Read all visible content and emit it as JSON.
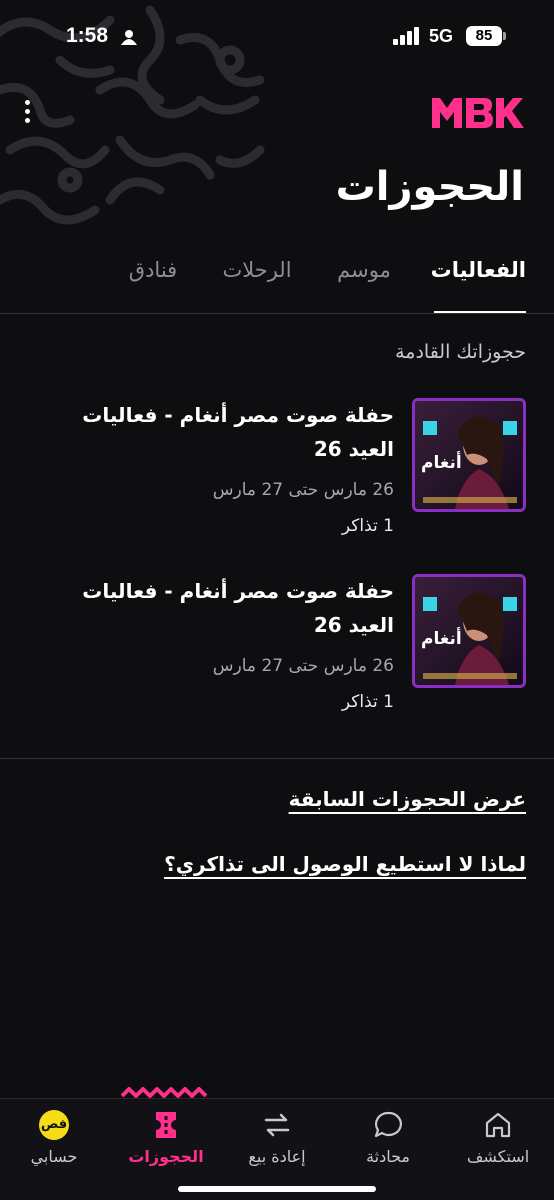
{
  "status_bar": {
    "time": "1:58",
    "network": "5G",
    "battery": "85"
  },
  "header": {
    "logo_text": "MBK",
    "title": "الحجوزات",
    "brand_color": "#ff2f8c"
  },
  "tabs": [
    {
      "label": "الفعاليات",
      "active": true
    },
    {
      "label": "موسم",
      "active": false
    },
    {
      "label": "الرحلات",
      "active": false
    },
    {
      "label": "فنادق",
      "active": false
    }
  ],
  "upcoming": {
    "section_title": "حجوزاتك القادمة",
    "bookings": [
      {
        "title": "حفلة صوت مصر أنغام  - فعاليات العيد 26",
        "dates": "26 مارس حتى 27 مارس",
        "tickets": "1 تذاكر",
        "poster_text": "أنغام"
      },
      {
        "title": "حفلة صوت مصر أنغام  - فعاليات العيد 26",
        "dates": "26 مارس حتى 27 مارس",
        "tickets": "1 تذاكر",
        "poster_text": "أنغام"
      }
    ]
  },
  "links": {
    "past_bookings": "عرض الحجوزات السابقة",
    "cant_access": "لماذا لا استطيع الوصول الى تذاكري؟"
  },
  "bottom_nav": {
    "items": [
      {
        "label": "حسابي",
        "icon": "avatar-fes",
        "badge": "فص"
      },
      {
        "label": "الحجوزات",
        "icon": "ticket-icon",
        "active": true
      },
      {
        "label": "إعادة بيع",
        "icon": "resell-icon"
      },
      {
        "label": "محادثة",
        "icon": "chat-icon"
      },
      {
        "label": "استكشف",
        "icon": "home-icon"
      }
    ]
  }
}
